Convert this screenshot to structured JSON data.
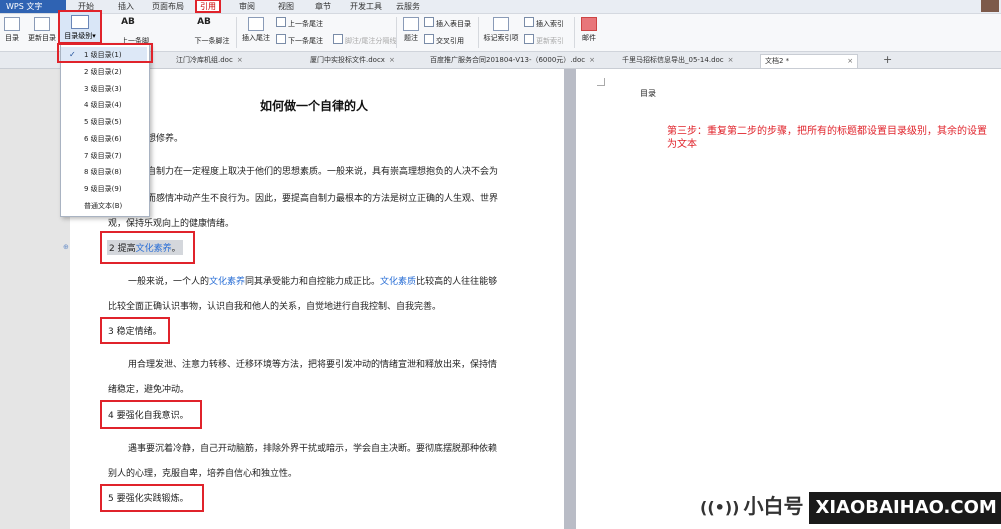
{
  "menubar": {
    "app_label": "WPS 文字",
    "tabs": [
      "开始",
      "插入",
      "页面布局",
      "引用",
      "审阅",
      "视图",
      "章节",
      "开发工具",
      "云服务"
    ],
    "active_tab": "引用"
  },
  "ribbon": {
    "toc": "目录",
    "update_toc": "更新目录",
    "toc_level": "目录级别",
    "next_footnote_top": "AB",
    "prev_footnote": "上一条脚注",
    "next_footnote": "下一条脚注",
    "insert_endnote": "插入尾注",
    "prev_endnote": "上一条尾注",
    "next_endnote": "下一条尾注",
    "footnote_separator": "脚注/尾注分隔线",
    "caption": "题注",
    "insert_table_of_figures": "插入表目录",
    "cross_reference": "交叉引用",
    "mark_index_entry": "标记索引项",
    "insert_index": "插入索引",
    "update_index": "更新索引",
    "mail": "邮件"
  },
  "doc_tabs": [
    "江门冷库机组.doc",
    "厦门中实投标文件.docx",
    "百度推广服务合同201804-V13-（6000元）.doc",
    "千里马招标信息导出_05-14.doc",
    "文档2 *"
  ],
  "dropdown": {
    "items": [
      "1 级目录(1)",
      "2 级目录(2)",
      "3 级目录(3)",
      "4 级目录(4)",
      "5 级目录(5)",
      "6 级目录(6)",
      "7 级目录(7)",
      "8 级目录(8)",
      "9 级目录(9)",
      "普通文本(B)"
    ],
    "selected": "1 级目录(1)"
  },
  "document": {
    "title": "如何做一个自律的人",
    "h1_partial": "想修养。",
    "p1_l1": "自制力在一定程度上取决于他们的思想素质。一般来说，具有崇高理想抱负的人决不会为",
    "p1_l2": "而感情冲动产生不良行为。因此，要提高自制力最根本的方法是树立正确的人生观、世界",
    "p1_l3": "观，保持乐观向上的健康情绪。",
    "h2_prefix": "2 提高",
    "h2_link": "文化素养",
    "h2_suffix": "。",
    "p2_l1_a": "一般来说，一个人的",
    "p2_l1_b": "文化素养",
    "p2_l1_c": "同其承受能力和自控能力成正比。",
    "p2_l1_d": "文化素质",
    "p2_l1_e": "比较高的人往往能够",
    "p2_l2": "比较全面正确认识事物，认识自我和他人的关系，自觉地进行自我控制、自我完善。",
    "h3": "3 稳定情绪。",
    "p3_l1": "用合理发泄、注意力转移、迁移环境等方法，把将要引发冲动的情绪宣泄和释放出来，保持情",
    "p3_l2": "绪稳定，避免冲动。",
    "h4": "4 要强化自我意识。",
    "p4_l1": "遇事要沉着冷静，自己开动脑筋，排除外界干扰或暗示，学会自主决断。要彻底摆脱那种依赖",
    "p4_l2": "别人的心理，克服自卑，培养自信心和独立性。",
    "h5": "5 要强化实践锻炼。"
  },
  "right_page": {
    "toc_label": "目录",
    "instruction": "第三步：重复第二步的步骤，把所有的标题都设置目录级别，其余的设置为文本"
  },
  "brand": {
    "name": "小白号",
    "url": "XIAOBAIHAO.COM"
  },
  "colors": {
    "accent_red": "#e0232b",
    "link_blue": "#2a6fd6",
    "app_blue": "#2f63b3"
  }
}
